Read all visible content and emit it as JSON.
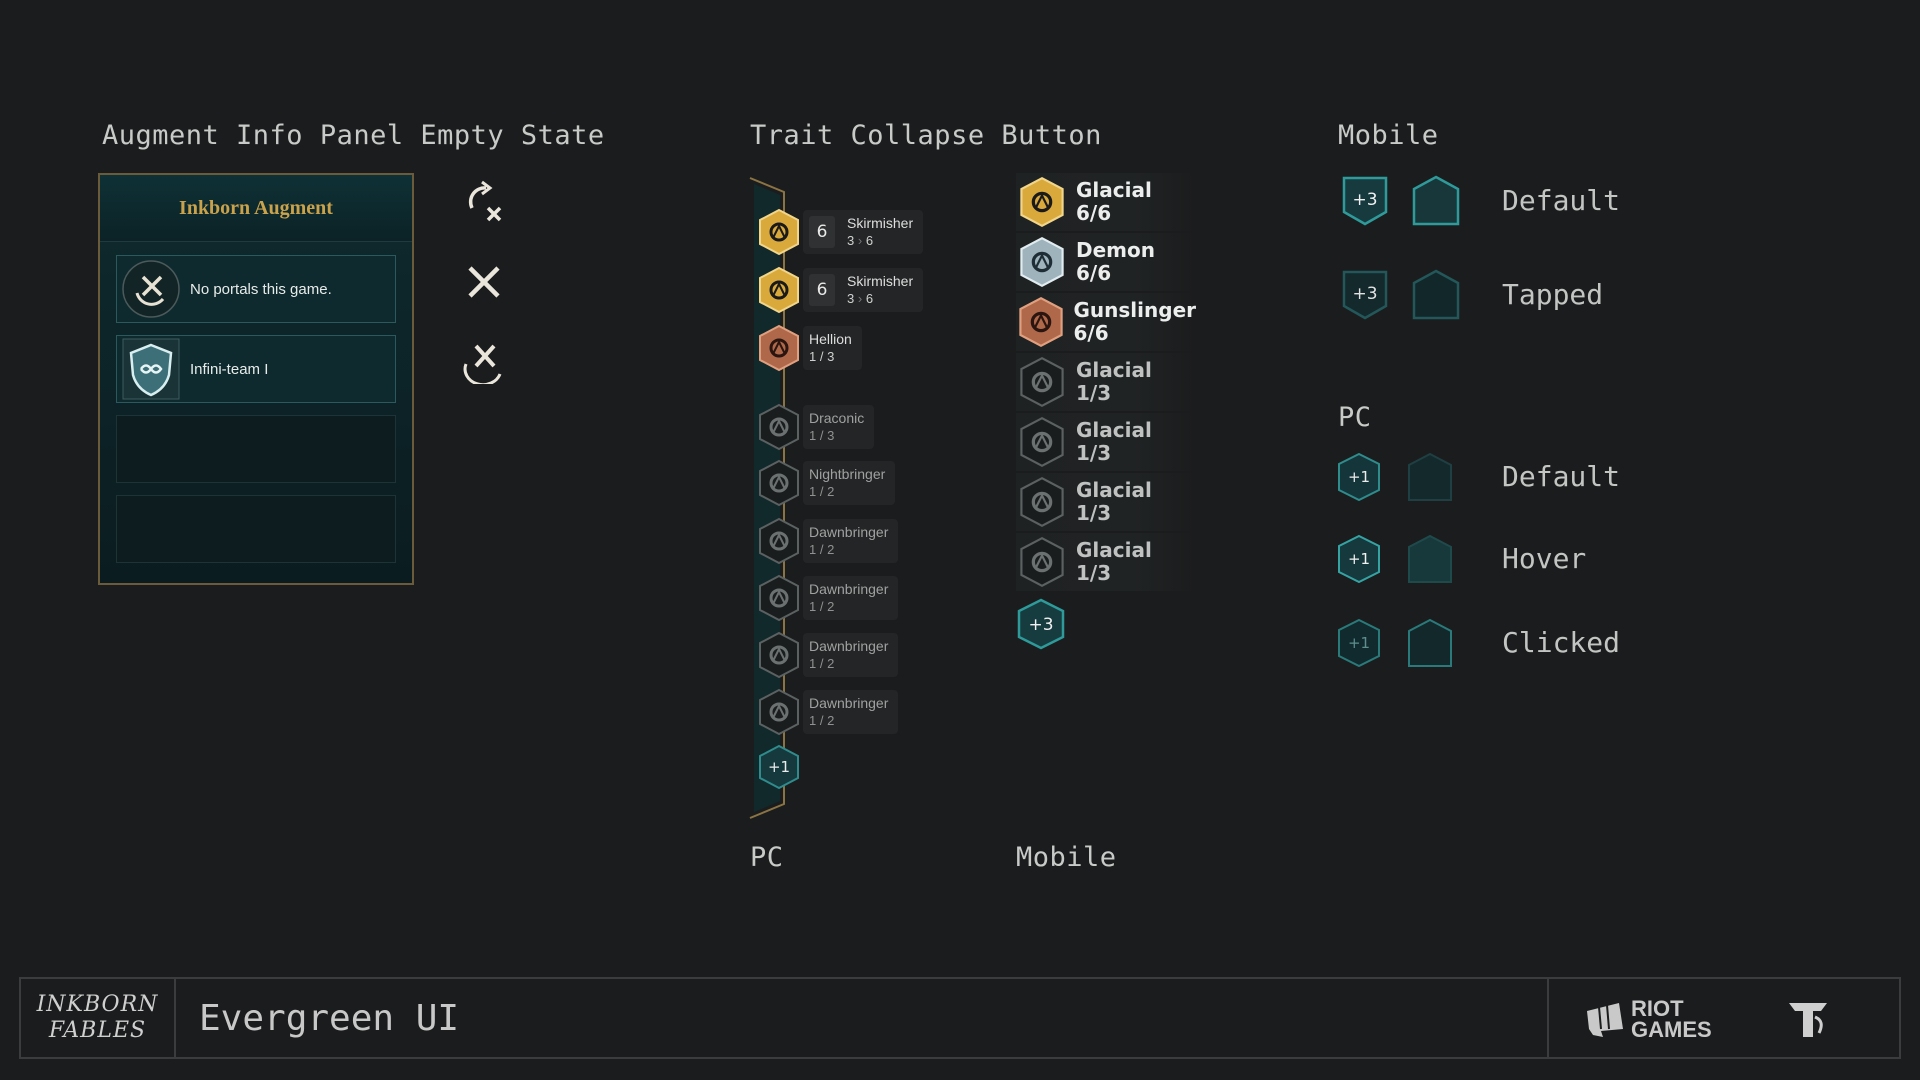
{
  "headings": {
    "augment": "Augment Info Panel Empty State",
    "trait_collapse": "Trait Collapse Button",
    "mobile": "Mobile",
    "pc": "PC"
  },
  "augment_panel": {
    "title": "Inkborn Augment",
    "slots": [
      {
        "label": "No portals this game.",
        "icon": "no-portal-icon"
      },
      {
        "label": "Infini-team I",
        "icon": "infini-team-shield-icon"
      }
    ]
  },
  "trait_pc": {
    "label": "PC",
    "rows": [
      {
        "count": "6",
        "name": "Skirmisher",
        "progress_from": "3",
        "arrow": "›",
        "progress_to": "6",
        "tier": "gold"
      },
      {
        "count": "6",
        "name": "Skirmisher",
        "progress_from": "3",
        "arrow": "›",
        "progress_to": "6",
        "tier": "gold"
      },
      {
        "name": "Hellion",
        "progress": "1 / 3",
        "tier": "bronze"
      },
      {
        "name": "Draconic",
        "progress": "1 / 3",
        "tier": "inactive"
      },
      {
        "name": "Nightbringer",
        "progress": "1 / 2",
        "tier": "inactive"
      },
      {
        "name": "Dawnbringer",
        "progress": "1 / 2",
        "tier": "inactive"
      },
      {
        "name": "Dawnbringer",
        "progress": "1 / 2",
        "tier": "inactive"
      },
      {
        "name": "Dawnbringer",
        "progress": "1 / 2",
        "tier": "inactive"
      },
      {
        "name": "Dawnbringer",
        "progress": "1 / 2",
        "tier": "inactive"
      }
    ],
    "more_button": "+1"
  },
  "trait_mobile": {
    "label": "Mobile",
    "rows": [
      {
        "name": "Glacial",
        "value": "6/6",
        "tier": "gold"
      },
      {
        "name": "Demon",
        "value": "6/6",
        "tier": "silver"
      },
      {
        "name": "Gunslinger",
        "value": "6/6",
        "tier": "bronze"
      },
      {
        "name": "Glacial",
        "value": "1/3",
        "tier": "inactive"
      },
      {
        "name": "Glacial",
        "value": "1/3",
        "tier": "inactive"
      },
      {
        "name": "Glacial",
        "value": "1/3",
        "tier": "inactive"
      },
      {
        "name": "Glacial",
        "value": "1/3",
        "tier": "inactive"
      }
    ],
    "more_button": "+3"
  },
  "button_states": {
    "mobile": [
      {
        "badge": "+3",
        "state": "Default"
      },
      {
        "badge": "+3",
        "state": "Tapped"
      }
    ],
    "pc": [
      {
        "badge": "+1",
        "state": "Default"
      },
      {
        "badge": "+1",
        "state": "Hover"
      },
      {
        "badge": "+1",
        "state": "Clicked"
      }
    ]
  },
  "footer": {
    "logo_line1": "INKBORN",
    "logo_line2": "FABLES",
    "title": "Evergreen UI",
    "brand": "RIOT GAMES",
    "brand_line1": "RIOT",
    "brand_line2": "GAMES"
  },
  "colors": {
    "gold": "#d9a93c",
    "silver": "#9fb3bd",
    "bronze": "#b0684a",
    "teal": "#2f8b8c",
    "panel_border": "#6b5b3a"
  }
}
